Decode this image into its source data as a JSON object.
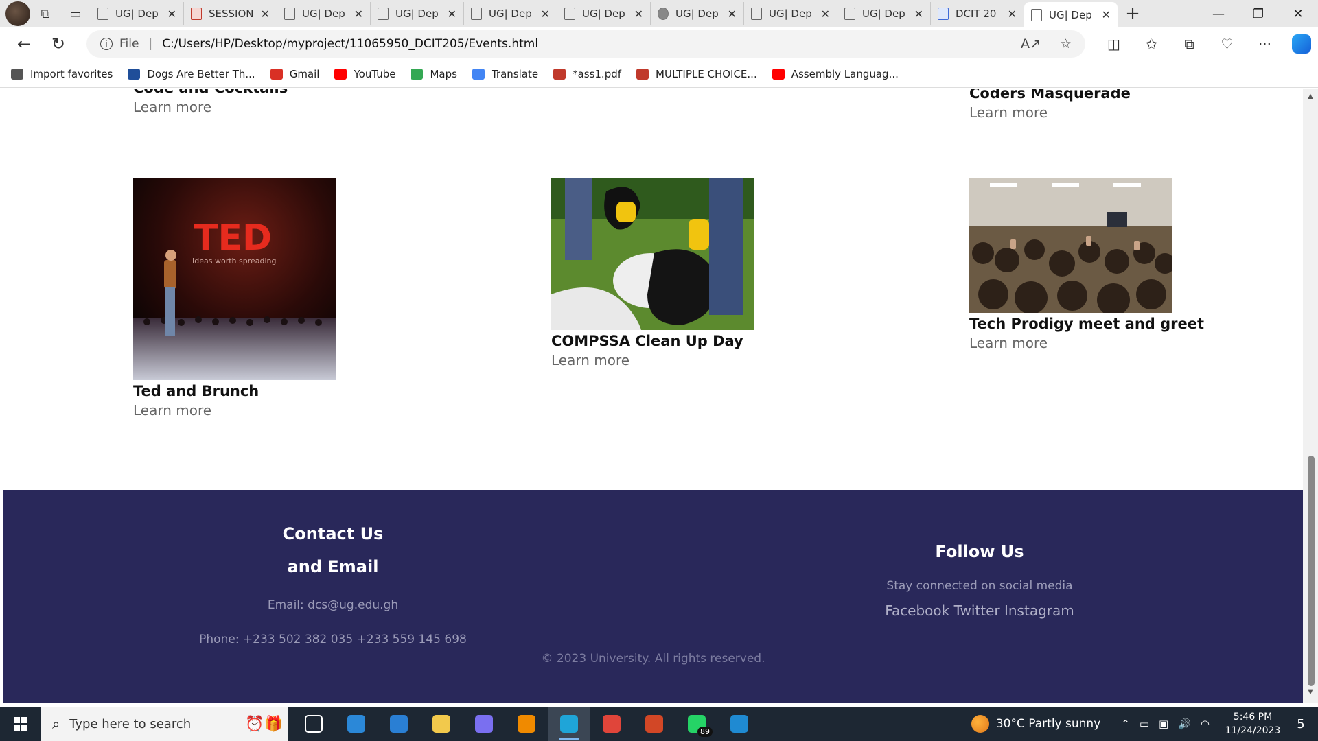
{
  "browser": {
    "tabs": [
      {
        "label": "UG| Dep",
        "icon": "page-icon",
        "active": false
      },
      {
        "label": "SESSION",
        "icon": "pdf-icon",
        "active": false
      },
      {
        "label": "UG| Dep",
        "icon": "page-icon",
        "active": false
      },
      {
        "label": "UG| Dep",
        "icon": "page-icon",
        "active": false
      },
      {
        "label": "UG| Dep",
        "icon": "page-icon",
        "active": false
      },
      {
        "label": "UG| Dep",
        "icon": "page-icon",
        "active": false
      },
      {
        "label": "UG| Dep",
        "icon": "shield-icon",
        "active": false
      },
      {
        "label": "UG| Dep",
        "icon": "page-icon",
        "active": false
      },
      {
        "label": "UG| Dep",
        "icon": "page-icon",
        "active": false
      },
      {
        "label": "DCIT 20",
        "icon": "doc-icon",
        "active": false
      },
      {
        "label": "UG| Dep",
        "icon": "page-icon",
        "active": true
      }
    ],
    "address": {
      "scheme_label": "File",
      "separator": "|",
      "url": "C:/Users/HP/Desktop/myproject/11065950_DCIT205/Events.html"
    },
    "favorites": [
      {
        "label": "Import favorites",
        "icon": "import-icon",
        "color": "#555555"
      },
      {
        "label": "Dogs Are Better Th...",
        "icon": "eb-icon",
        "color": "#1f4e99"
      },
      {
        "label": "Gmail",
        "icon": "gmail-icon",
        "color": "#d93025"
      },
      {
        "label": "YouTube",
        "icon": "youtube-icon",
        "color": "#ff0000"
      },
      {
        "label": "Maps",
        "icon": "maps-icon",
        "color": "#34a853"
      },
      {
        "label": "Translate",
        "icon": "translate-icon",
        "color": "#4285f4"
      },
      {
        "label": "*ass1.pdf",
        "icon": "pdf-icon",
        "color": "#c0392b"
      },
      {
        "label": "MULTIPLE CHOICE...",
        "icon": "pdf-icon",
        "color": "#c0392b"
      },
      {
        "label": "Assembly Languag...",
        "icon": "youtube-icon",
        "color": "#ff0000"
      }
    ]
  },
  "page": {
    "top_events": [
      {
        "name": "Code and Cocktails",
        "link": "Learn more"
      },
      {
        "name": "Coders Masquerade",
        "link": "Learn more"
      }
    ],
    "events": [
      {
        "name": "Ted and Brunch",
        "link": "Learn more",
        "image": "ted-talk-stage-photo"
      },
      {
        "name": "COMPSSA Clean Up Day",
        "link": "Learn more",
        "image": "cleanup-trash-bag-photo"
      },
      {
        "name": "Tech Prodigy meet and greet",
        "link": "Learn more",
        "image": "crowd-meetup-photo"
      }
    ],
    "footer": {
      "contact_title_1": "Contact Us",
      "contact_title_2": "and Email",
      "email": "Email: dcs@ug.edu.gh",
      "phone": "Phone: +233 502 382 035 +233 559 145 698",
      "follow_title": "Follow Us",
      "follow_text": "Stay connected on social media",
      "social_links": "Facebook Twitter Instagram",
      "copyright": "© 2023 University. All rights reserved.",
      "bg_color": "#29285a"
    }
  },
  "taskbar": {
    "search_placeholder": "Type here to search",
    "apps": [
      {
        "name": "task-view",
        "color": "#ffffff"
      },
      {
        "name": "microsoft-store",
        "color": "#2b88d8"
      },
      {
        "name": "mail",
        "color": "#2a7fd4"
      },
      {
        "name": "file-explorer",
        "color": "#f2c94c"
      },
      {
        "name": "copilot-app",
        "color": "#7a6ff0"
      },
      {
        "name": "vlc",
        "color": "#f08a00"
      },
      {
        "name": "edge",
        "color": "#1fa5d8",
        "active": true
      },
      {
        "name": "chrome",
        "color": "#e0453a"
      },
      {
        "name": "powerpoint",
        "color": "#d24726"
      },
      {
        "name": "whatsapp",
        "color": "#25d366",
        "badge": "89"
      },
      {
        "name": "vscode",
        "color": "#1f8ad2"
      }
    ],
    "weather": "30°C  Partly sunny",
    "time": "5:46 PM",
    "date": "11/24/2023",
    "notifications": "5"
  }
}
